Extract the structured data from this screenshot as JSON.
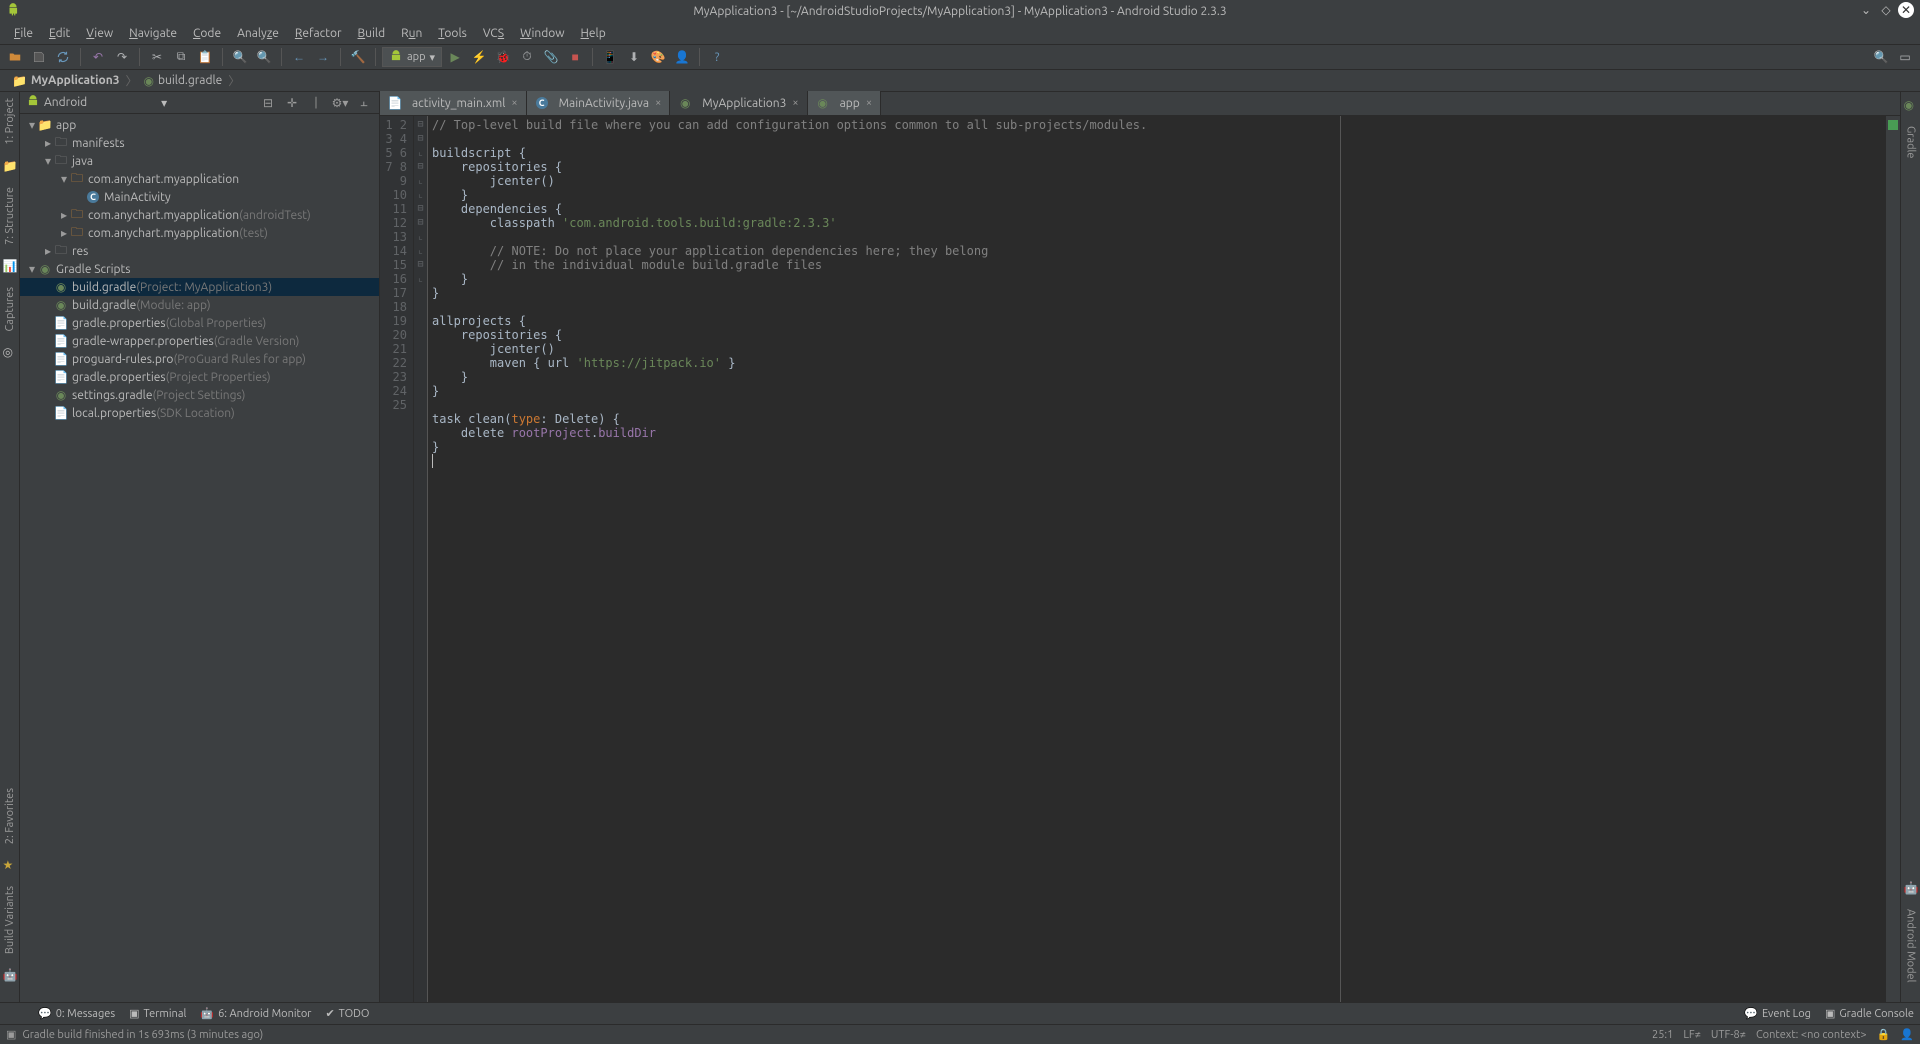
{
  "window": {
    "title": "MyApplication3 - [~/AndroidStudioProjects/MyApplication3] - MyApplication3 - Android Studio 2.3.3"
  },
  "menu": {
    "items": [
      "File",
      "Edit",
      "View",
      "Navigate",
      "Code",
      "Analyze",
      "Refactor",
      "Build",
      "Run",
      "Tools",
      "VCS",
      "Window",
      "Help"
    ]
  },
  "toolbar": {
    "run_config_label": "app"
  },
  "breadcrumb": {
    "items": [
      "MyApplication3",
      "build.gradle"
    ]
  },
  "project_panel": {
    "view_label": "Android",
    "tree": [
      {
        "depth": 0,
        "exp": "▾",
        "icon": "folder",
        "label": "app"
      },
      {
        "depth": 1,
        "exp": "▸",
        "icon": "folder-o",
        "label": "manifests"
      },
      {
        "depth": 1,
        "exp": "▾",
        "icon": "folder-o",
        "label": "java"
      },
      {
        "depth": 2,
        "exp": "▾",
        "icon": "package",
        "label": "com.anychart.myapplication"
      },
      {
        "depth": 3,
        "exp": " ",
        "icon": "class",
        "label": "MainActivity"
      },
      {
        "depth": 2,
        "exp": "▸",
        "icon": "package",
        "label": "com.anychart.myapplication",
        "suffix": "(androidTest)"
      },
      {
        "depth": 2,
        "exp": "▸",
        "icon": "package",
        "label": "com.anychart.myapplication",
        "suffix": "(test)"
      },
      {
        "depth": 1,
        "exp": "▸",
        "icon": "folder-o",
        "label": "res"
      },
      {
        "depth": 0,
        "exp": "▾",
        "icon": "gradle",
        "label": "Gradle Scripts"
      },
      {
        "depth": 1,
        "exp": " ",
        "icon": "gradle-file",
        "label": "build.gradle",
        "suffix": "(Project: MyApplication3)",
        "selected": true
      },
      {
        "depth": 1,
        "exp": " ",
        "icon": "gradle-file",
        "label": "build.gradle",
        "suffix": "(Module: app)"
      },
      {
        "depth": 1,
        "exp": " ",
        "icon": "props",
        "label": "gradle.properties",
        "suffix": "(Global Properties)"
      },
      {
        "depth": 1,
        "exp": " ",
        "icon": "props",
        "label": "gradle-wrapper.properties",
        "suffix": "(Gradle Version)"
      },
      {
        "depth": 1,
        "exp": " ",
        "icon": "file",
        "label": "proguard-rules.pro",
        "suffix": "(ProGuard Rules for app)"
      },
      {
        "depth": 1,
        "exp": " ",
        "icon": "props",
        "label": "gradle.properties",
        "suffix": "(Project Properties)"
      },
      {
        "depth": 1,
        "exp": " ",
        "icon": "gradle-file",
        "label": "settings.gradle",
        "suffix": "(Project Settings)"
      },
      {
        "depth": 1,
        "exp": " ",
        "icon": "props",
        "label": "local.properties",
        "suffix": "(SDK Location)"
      }
    ]
  },
  "left_tool_windows": [
    {
      "id": "project",
      "label": "1: Project"
    },
    {
      "id": "structure",
      "label": "7: Structure"
    },
    {
      "id": "captures",
      "label": "Captures"
    }
  ],
  "left_tool_windows_b": [
    {
      "id": "favorites",
      "label": "2: Favorites"
    },
    {
      "id": "build-variants",
      "label": "Build Variants"
    }
  ],
  "right_tool_windows": [
    {
      "id": "gradle",
      "label": "Gradle"
    }
  ],
  "right_tool_windows_b": [
    {
      "id": "android-model",
      "label": "Android Model"
    }
  ],
  "editor": {
    "tabs": [
      {
        "label": "activity_main.xml",
        "icon": "xml",
        "active": false
      },
      {
        "label": "MainActivity.java",
        "icon": "class",
        "active": false
      },
      {
        "label": "MyApplication3",
        "icon": "gradle-file",
        "active": true
      },
      {
        "label": "app",
        "icon": "gradle-file",
        "active": false
      }
    ],
    "lines_count": 25
  },
  "bottom_tools": {
    "items": [
      {
        "id": "messages",
        "label": "0: Messages"
      },
      {
        "id": "terminal",
        "label": "Terminal"
      },
      {
        "id": "android-monitor",
        "label": "6: Android Monitor"
      },
      {
        "id": "todo",
        "label": "TODO"
      }
    ],
    "right": [
      {
        "id": "event-log",
        "label": "Event Log"
      },
      {
        "id": "gradle-console",
        "label": "Gradle Console"
      }
    ]
  },
  "status": {
    "message": "Gradle build finished in 1s 693ms (3 minutes ago)",
    "cursor": "25:1",
    "line_sep": "LF≠",
    "encoding": "UTF-8≠",
    "context": "Context: <no context>"
  },
  "code": {
    "l1": "// Top-level build file where you can add configuration options common to all sub-projects/modules.",
    "l2": "",
    "l3a": "buildscript ",
    "l4a": "    repositories ",
    "l5": "        jcenter()",
    "l6": "    }",
    "l7a": "    dependencies ",
    "l8a": "        classpath ",
    "l8b": "'com.android.tools.build:gradle:2.3.3'",
    "l9": "",
    "l10": "        // NOTE: Do not place your application dependencies here; they belong",
    "l11": "        // in the individual module build.gradle files",
    "l12": "    }",
    "l13": "}",
    "l14": "",
    "l15a": "allprojects ",
    "l16a": "    repositories ",
    "l17": "        jcenter()",
    "l18a": "        maven { url ",
    "l18b": "'https://jitpack.io'",
    "l18c": " }",
    "l19": "    }",
    "l20": "}",
    "l21": "",
    "l22a": "task clean(",
    "l22b": "type",
    "l22c": ": Delete) {",
    "l23a": "    delete ",
    "l23b": "rootProject",
    "l23c": ".",
    "l23d": "buildDir",
    "l24": "}"
  }
}
